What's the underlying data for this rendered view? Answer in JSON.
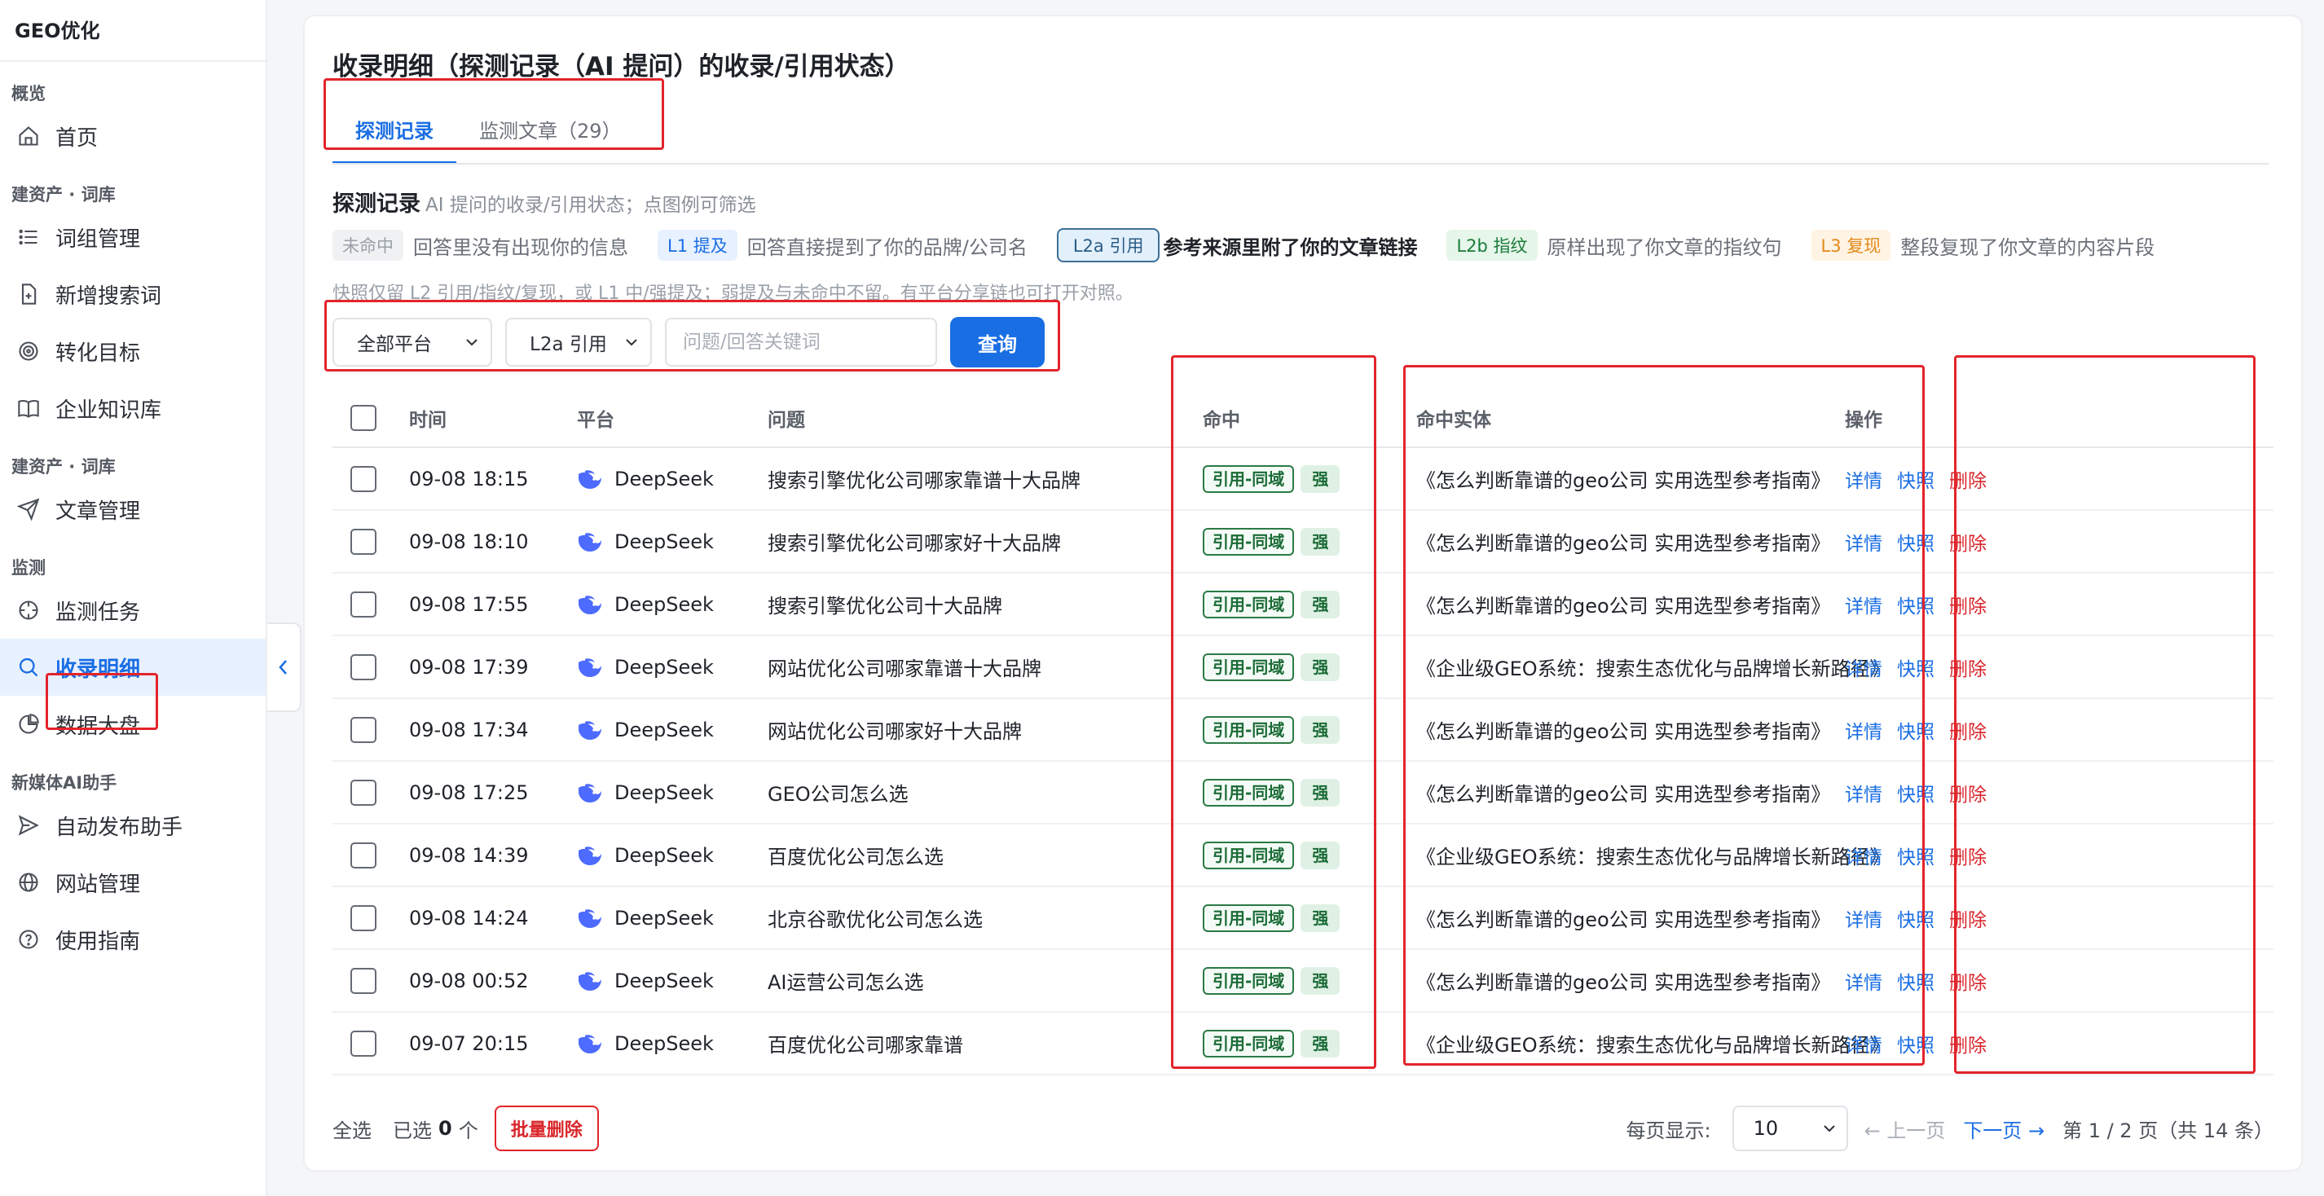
{
  "app": {
    "brand": "GEO优化"
  },
  "sidebar": {
    "sections": [
      {
        "title": "概览",
        "items": [
          {
            "label": "首页",
            "icon": "home-icon"
          }
        ]
      },
      {
        "title": "建资产 · 词库",
        "items": [
          {
            "label": "词组管理",
            "icon": "list-icon"
          },
          {
            "label": "新增搜索词",
            "icon": "file-plus-icon"
          },
          {
            "label": "转化目标",
            "icon": "target-icon"
          },
          {
            "label": "企业知识库",
            "icon": "book-icon"
          }
        ]
      },
      {
        "title": "建资产 · 词库",
        "items": [
          {
            "label": "文章管理",
            "icon": "send-icon"
          }
        ]
      },
      {
        "title": "监测",
        "items": [
          {
            "label": "监测任务",
            "icon": "crosshair-icon"
          },
          {
            "label": "收录明细",
            "icon": "search-icon",
            "active": true
          },
          {
            "label": "数据大盘",
            "icon": "pie-chart-icon"
          }
        ]
      },
      {
        "title": "新媒体AI助手",
        "items": [
          {
            "label": "自动发布助手",
            "icon": "paper-plane-icon"
          },
          {
            "label": "网站管理",
            "icon": "globe-icon"
          },
          {
            "label": "使用指南",
            "icon": "help-circle-icon"
          }
        ]
      }
    ]
  },
  "page": {
    "title": "收录明细（探测记录（AI 提问）的收录/引用状态）",
    "tabs": [
      {
        "label": "探测记录",
        "active": true
      },
      {
        "label": "监测文章（29）"
      }
    ]
  },
  "section": {
    "title": "探测记录",
    "desc": "AI 提问的收录/引用状态；点图例可筛选",
    "legend": [
      {
        "chip": "未命中",
        "text": "回答里没有出现你的信息"
      },
      {
        "chip": "L1 提及",
        "text": "回答直接提到了你的品牌/公司名"
      },
      {
        "chip": "L2a 引用",
        "text": "参考来源里附了你的文章链接"
      },
      {
        "chip": "L2b 指纹",
        "text": "原样出现了你文章的指纹句"
      },
      {
        "chip": "L3 复现",
        "text": "整段复现了你文章的内容片段"
      }
    ],
    "note": "快照仅留 L2 引用/指纹/复现，或 L1 中/强提及；弱提及与未命中不留。有平台分享链也可打开对照。"
  },
  "filters": {
    "platform": "全部平台",
    "level": "L2a 引用",
    "keyword_placeholder": "问题/回答关键词",
    "query_button": "查询"
  },
  "table": {
    "headers": {
      "time": "时间",
      "platform": "平台",
      "question": "问题",
      "hit": "命中",
      "entity": "命中实体",
      "action": "操作"
    },
    "rows": [
      {
        "time": "09-08 18:15",
        "platform": "DeepSeek",
        "question": "搜索引擎优化公司哪家靠谱十大品牌",
        "tag": "引用-同域",
        "strength": "强",
        "entity": "《怎么判断靠谱的geo公司 实用选型参考指南》"
      },
      {
        "time": "09-08 18:10",
        "platform": "DeepSeek",
        "question": "搜索引擎优化公司哪家好十大品牌",
        "tag": "引用-同域",
        "strength": "强",
        "entity": "《怎么判断靠谱的geo公司 实用选型参考指南》"
      },
      {
        "time": "09-08 17:55",
        "platform": "DeepSeek",
        "question": "搜索引擎优化公司十大品牌",
        "tag": "引用-同域",
        "strength": "强",
        "entity": "《怎么判断靠谱的geo公司 实用选型参考指南》"
      },
      {
        "time": "09-08 17:39",
        "platform": "DeepSeek",
        "question": "网站优化公司哪家靠谱十大品牌",
        "tag": "引用-同域",
        "strength": "强",
        "entity": "《企业级GEO系统：搜索生态优化与品牌增长新路径》"
      },
      {
        "time": "09-08 17:34",
        "platform": "DeepSeek",
        "question": "网站优化公司哪家好十大品牌",
        "tag": "引用-同域",
        "strength": "强",
        "entity": "《怎么判断靠谱的geo公司 实用选型参考指南》"
      },
      {
        "time": "09-08 17:25",
        "platform": "DeepSeek",
        "question": "GEO公司怎么选",
        "tag": "引用-同域",
        "strength": "强",
        "entity": "《怎么判断靠谱的geo公司 实用选型参考指南》"
      },
      {
        "time": "09-08 14:39",
        "platform": "DeepSeek",
        "question": "百度优化公司怎么选",
        "tag": "引用-同域",
        "strength": "强",
        "entity": "《企业级GEO系统：搜索生态优化与品牌增长新路径》"
      },
      {
        "time": "09-08 14:24",
        "platform": "DeepSeek",
        "question": "北京谷歌优化公司怎么选",
        "tag": "引用-同域",
        "strength": "强",
        "entity": "《怎么判断靠谱的geo公司 实用选型参考指南》"
      },
      {
        "time": "09-08 00:52",
        "platform": "DeepSeek",
        "question": "AI运营公司怎么选",
        "tag": "引用-同域",
        "strength": "强",
        "entity": "《怎么判断靠谱的geo公司 实用选型参考指南》"
      },
      {
        "time": "09-07 20:15",
        "platform": "DeepSeek",
        "question": "百度优化公司哪家靠谱",
        "tag": "引用-同域",
        "strength": "强",
        "entity": "《企业级GEO系统：搜索生态优化与品牌增长新路径》"
      }
    ],
    "actions": {
      "detail": "详情",
      "snapshot": "快照",
      "delete": "删除"
    }
  },
  "footer": {
    "select_all": "全选",
    "selected_prefix": "已选",
    "selected_count": "0",
    "selected_suffix": "个",
    "batch_delete": "批量删除",
    "page_size_label": "每页显示:",
    "page_size": "10",
    "prev": "← 上一页",
    "next": "下一页 →",
    "page_info": "第 1 / 2 页（共 14 条）"
  },
  "colors": {
    "accent": "#1a6ee3",
    "danger": "#d9262c",
    "success": "#1b6b37",
    "highlight_box": "#e3242b"
  }
}
